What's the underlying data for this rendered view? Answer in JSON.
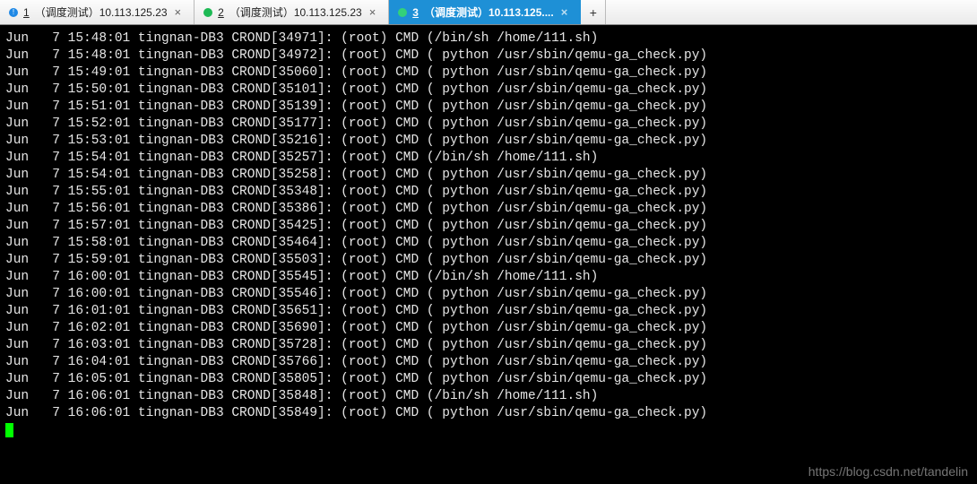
{
  "tabs": [
    {
      "status": "blue",
      "status_name": "info-icon",
      "number": "1",
      "label": "（调度测试）10.113.125.23",
      "active": false
    },
    {
      "status": "green",
      "status_name": "status-dot-icon",
      "number": "2",
      "label": "（调度测试）10.113.125.23",
      "active": false
    },
    {
      "status": "greenlt",
      "status_name": "status-dot-icon",
      "number": "3",
      "label": "（调度测试）10.113.125....",
      "active": true
    }
  ],
  "new_tab_label": "+",
  "close_label": "×",
  "watermark": "https://blog.csdn.net/tandelin",
  "log_entries": [
    {
      "month": "Jun",
      "day": "7",
      "time": "15:48:01",
      "host": "tingnan-DB3",
      "proc": "CROND",
      "pid": "34971",
      "user": "root",
      "cmd_prefix": "CMD",
      "command": "/bin/sh /home/111.sh"
    },
    {
      "month": "Jun",
      "day": "7",
      "time": "15:48:01",
      "host": "tingnan-DB3",
      "proc": "CROND",
      "pid": "34972",
      "user": "root",
      "cmd_prefix": "CMD",
      "command": " python /usr/sbin/qemu-ga_check.py"
    },
    {
      "month": "Jun",
      "day": "7",
      "time": "15:49:01",
      "host": "tingnan-DB3",
      "proc": "CROND",
      "pid": "35060",
      "user": "root",
      "cmd_prefix": "CMD",
      "command": " python /usr/sbin/qemu-ga_check.py"
    },
    {
      "month": "Jun",
      "day": "7",
      "time": "15:50:01",
      "host": "tingnan-DB3",
      "proc": "CROND",
      "pid": "35101",
      "user": "root",
      "cmd_prefix": "CMD",
      "command": " python /usr/sbin/qemu-ga_check.py"
    },
    {
      "month": "Jun",
      "day": "7",
      "time": "15:51:01",
      "host": "tingnan-DB3",
      "proc": "CROND",
      "pid": "35139",
      "user": "root",
      "cmd_prefix": "CMD",
      "command": " python /usr/sbin/qemu-ga_check.py"
    },
    {
      "month": "Jun",
      "day": "7",
      "time": "15:52:01",
      "host": "tingnan-DB3",
      "proc": "CROND",
      "pid": "35177",
      "user": "root",
      "cmd_prefix": "CMD",
      "command": " python /usr/sbin/qemu-ga_check.py"
    },
    {
      "month": "Jun",
      "day": "7",
      "time": "15:53:01",
      "host": "tingnan-DB3",
      "proc": "CROND",
      "pid": "35216",
      "user": "root",
      "cmd_prefix": "CMD",
      "command": " python /usr/sbin/qemu-ga_check.py"
    },
    {
      "month": "Jun",
      "day": "7",
      "time": "15:54:01",
      "host": "tingnan-DB3",
      "proc": "CROND",
      "pid": "35257",
      "user": "root",
      "cmd_prefix": "CMD",
      "command": "/bin/sh /home/111.sh"
    },
    {
      "month": "Jun",
      "day": "7",
      "time": "15:54:01",
      "host": "tingnan-DB3",
      "proc": "CROND",
      "pid": "35258",
      "user": "root",
      "cmd_prefix": "CMD",
      "command": " python /usr/sbin/qemu-ga_check.py"
    },
    {
      "month": "Jun",
      "day": "7",
      "time": "15:55:01",
      "host": "tingnan-DB3",
      "proc": "CROND",
      "pid": "35348",
      "user": "root",
      "cmd_prefix": "CMD",
      "command": " python /usr/sbin/qemu-ga_check.py"
    },
    {
      "month": "Jun",
      "day": "7",
      "time": "15:56:01",
      "host": "tingnan-DB3",
      "proc": "CROND",
      "pid": "35386",
      "user": "root",
      "cmd_prefix": "CMD",
      "command": " python /usr/sbin/qemu-ga_check.py"
    },
    {
      "month": "Jun",
      "day": "7",
      "time": "15:57:01",
      "host": "tingnan-DB3",
      "proc": "CROND",
      "pid": "35425",
      "user": "root",
      "cmd_prefix": "CMD",
      "command": " python /usr/sbin/qemu-ga_check.py"
    },
    {
      "month": "Jun",
      "day": "7",
      "time": "15:58:01",
      "host": "tingnan-DB3",
      "proc": "CROND",
      "pid": "35464",
      "user": "root",
      "cmd_prefix": "CMD",
      "command": " python /usr/sbin/qemu-ga_check.py"
    },
    {
      "month": "Jun",
      "day": "7",
      "time": "15:59:01",
      "host": "tingnan-DB3",
      "proc": "CROND",
      "pid": "35503",
      "user": "root",
      "cmd_prefix": "CMD",
      "command": " python /usr/sbin/qemu-ga_check.py"
    },
    {
      "month": "Jun",
      "day": "7",
      "time": "16:00:01",
      "host": "tingnan-DB3",
      "proc": "CROND",
      "pid": "35545",
      "user": "root",
      "cmd_prefix": "CMD",
      "command": "/bin/sh /home/111.sh"
    },
    {
      "month": "Jun",
      "day": "7",
      "time": "16:00:01",
      "host": "tingnan-DB3",
      "proc": "CROND",
      "pid": "35546",
      "user": "root",
      "cmd_prefix": "CMD",
      "command": " python /usr/sbin/qemu-ga_check.py"
    },
    {
      "month": "Jun",
      "day": "7",
      "time": "16:01:01",
      "host": "tingnan-DB3",
      "proc": "CROND",
      "pid": "35651",
      "user": "root",
      "cmd_prefix": "CMD",
      "command": " python /usr/sbin/qemu-ga_check.py"
    },
    {
      "month": "Jun",
      "day": "7",
      "time": "16:02:01",
      "host": "tingnan-DB3",
      "proc": "CROND",
      "pid": "35690",
      "user": "root",
      "cmd_prefix": "CMD",
      "command": " python /usr/sbin/qemu-ga_check.py"
    },
    {
      "month": "Jun",
      "day": "7",
      "time": "16:03:01",
      "host": "tingnan-DB3",
      "proc": "CROND",
      "pid": "35728",
      "user": "root",
      "cmd_prefix": "CMD",
      "command": " python /usr/sbin/qemu-ga_check.py"
    },
    {
      "month": "Jun",
      "day": "7",
      "time": "16:04:01",
      "host": "tingnan-DB3",
      "proc": "CROND",
      "pid": "35766",
      "user": "root",
      "cmd_prefix": "CMD",
      "command": " python /usr/sbin/qemu-ga_check.py"
    },
    {
      "month": "Jun",
      "day": "7",
      "time": "16:05:01",
      "host": "tingnan-DB3",
      "proc": "CROND",
      "pid": "35805",
      "user": "root",
      "cmd_prefix": "CMD",
      "command": " python /usr/sbin/qemu-ga_check.py"
    },
    {
      "month": "Jun",
      "day": "7",
      "time": "16:06:01",
      "host": "tingnan-DB3",
      "proc": "CROND",
      "pid": "35848",
      "user": "root",
      "cmd_prefix": "CMD",
      "command": "/bin/sh /home/111.sh"
    },
    {
      "month": "Jun",
      "day": "7",
      "time": "16:06:01",
      "host": "tingnan-DB3",
      "proc": "CROND",
      "pid": "35849",
      "user": "root",
      "cmd_prefix": "CMD",
      "command": " python /usr/sbin/qemu-ga_check.py"
    }
  ]
}
